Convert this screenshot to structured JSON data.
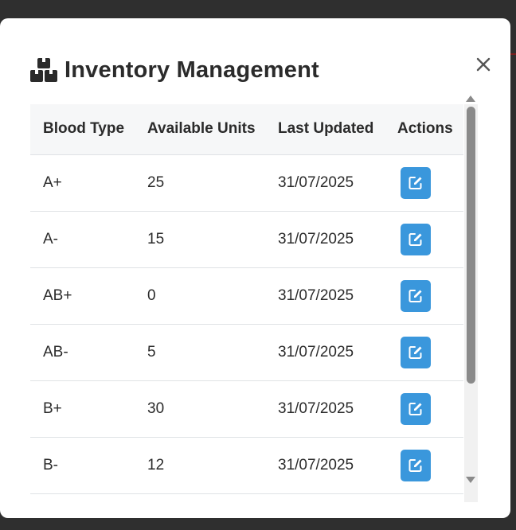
{
  "modal": {
    "title": "Inventory Management",
    "title_icon": "boxes-icon",
    "close_icon": "close-icon"
  },
  "table": {
    "headers": [
      "Blood Type",
      "Available Units",
      "Last Updated",
      "Actions"
    ],
    "rows": [
      {
        "blood_type": "A+",
        "units": "25",
        "updated": "31/07/2025"
      },
      {
        "blood_type": "A-",
        "units": "15",
        "updated": "31/07/2025"
      },
      {
        "blood_type": "AB+",
        "units": "0",
        "updated": "31/07/2025"
      },
      {
        "blood_type": "AB-",
        "units": "5",
        "updated": "31/07/2025"
      },
      {
        "blood_type": "B+",
        "units": "30",
        "updated": "31/07/2025"
      },
      {
        "blood_type": "B-",
        "units": "12",
        "updated": "31/07/2025"
      }
    ],
    "action_icon": "edit-icon"
  },
  "colors": {
    "accent": "#3a97dc",
    "title_text": "#2b2b2b",
    "header_bg": "#f6f7f8",
    "backdrop": "#2f2f2f"
  }
}
